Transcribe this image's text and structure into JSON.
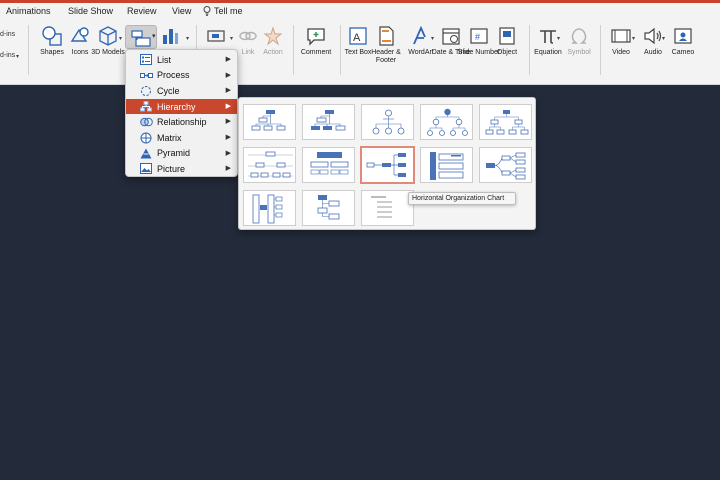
{
  "colors": {
    "accent": "#c8472d",
    "icon_blue": "#2f66b3",
    "canvas": "#232a3a",
    "ribbon": "#f3f3f3"
  },
  "menubar": {
    "tabs": [
      {
        "label": "Animations"
      },
      {
        "label": "Slide Show"
      },
      {
        "label": "Review"
      },
      {
        "label": "View"
      },
      {
        "label": "Tell me",
        "icon": "lightbulb-icon"
      }
    ]
  },
  "ribbon": {
    "addins_top": "d-ins",
    "addins_bottom": "d-ins",
    "shapes": "Shapes",
    "icons": "Icons",
    "models": "3D Models",
    "link": "Link",
    "action": "Action",
    "comment": "Comment",
    "textbox": "Text Box",
    "header_footer": "Header & Footer",
    "wordart": "WordArt",
    "datetime": "Date & Time",
    "slide_number": "Slide Number",
    "object": "Object",
    "equation": "Equation",
    "symbol": "Symbol",
    "video": "Video",
    "audio": "Audio",
    "cameo": "Cameo"
  },
  "smartart_menu": {
    "selected": "Hierarchy",
    "items": [
      {
        "label": "List",
        "icon": "list-icon"
      },
      {
        "label": "Process",
        "icon": "process-icon"
      },
      {
        "label": "Cycle",
        "icon": "cycle-icon"
      },
      {
        "label": "Hierarchy",
        "icon": "hierarchy-icon"
      },
      {
        "label": "Relationship",
        "icon": "relationship-icon"
      },
      {
        "label": "Matrix",
        "icon": "matrix-icon"
      },
      {
        "label": "Pyramid",
        "icon": "pyramid-icon"
      },
      {
        "label": "Picture",
        "icon": "picture-icon"
      }
    ]
  },
  "gallery": {
    "tooltip": "Horizontal Organization Chart",
    "selected_index": 7,
    "layout_count": 13
  }
}
